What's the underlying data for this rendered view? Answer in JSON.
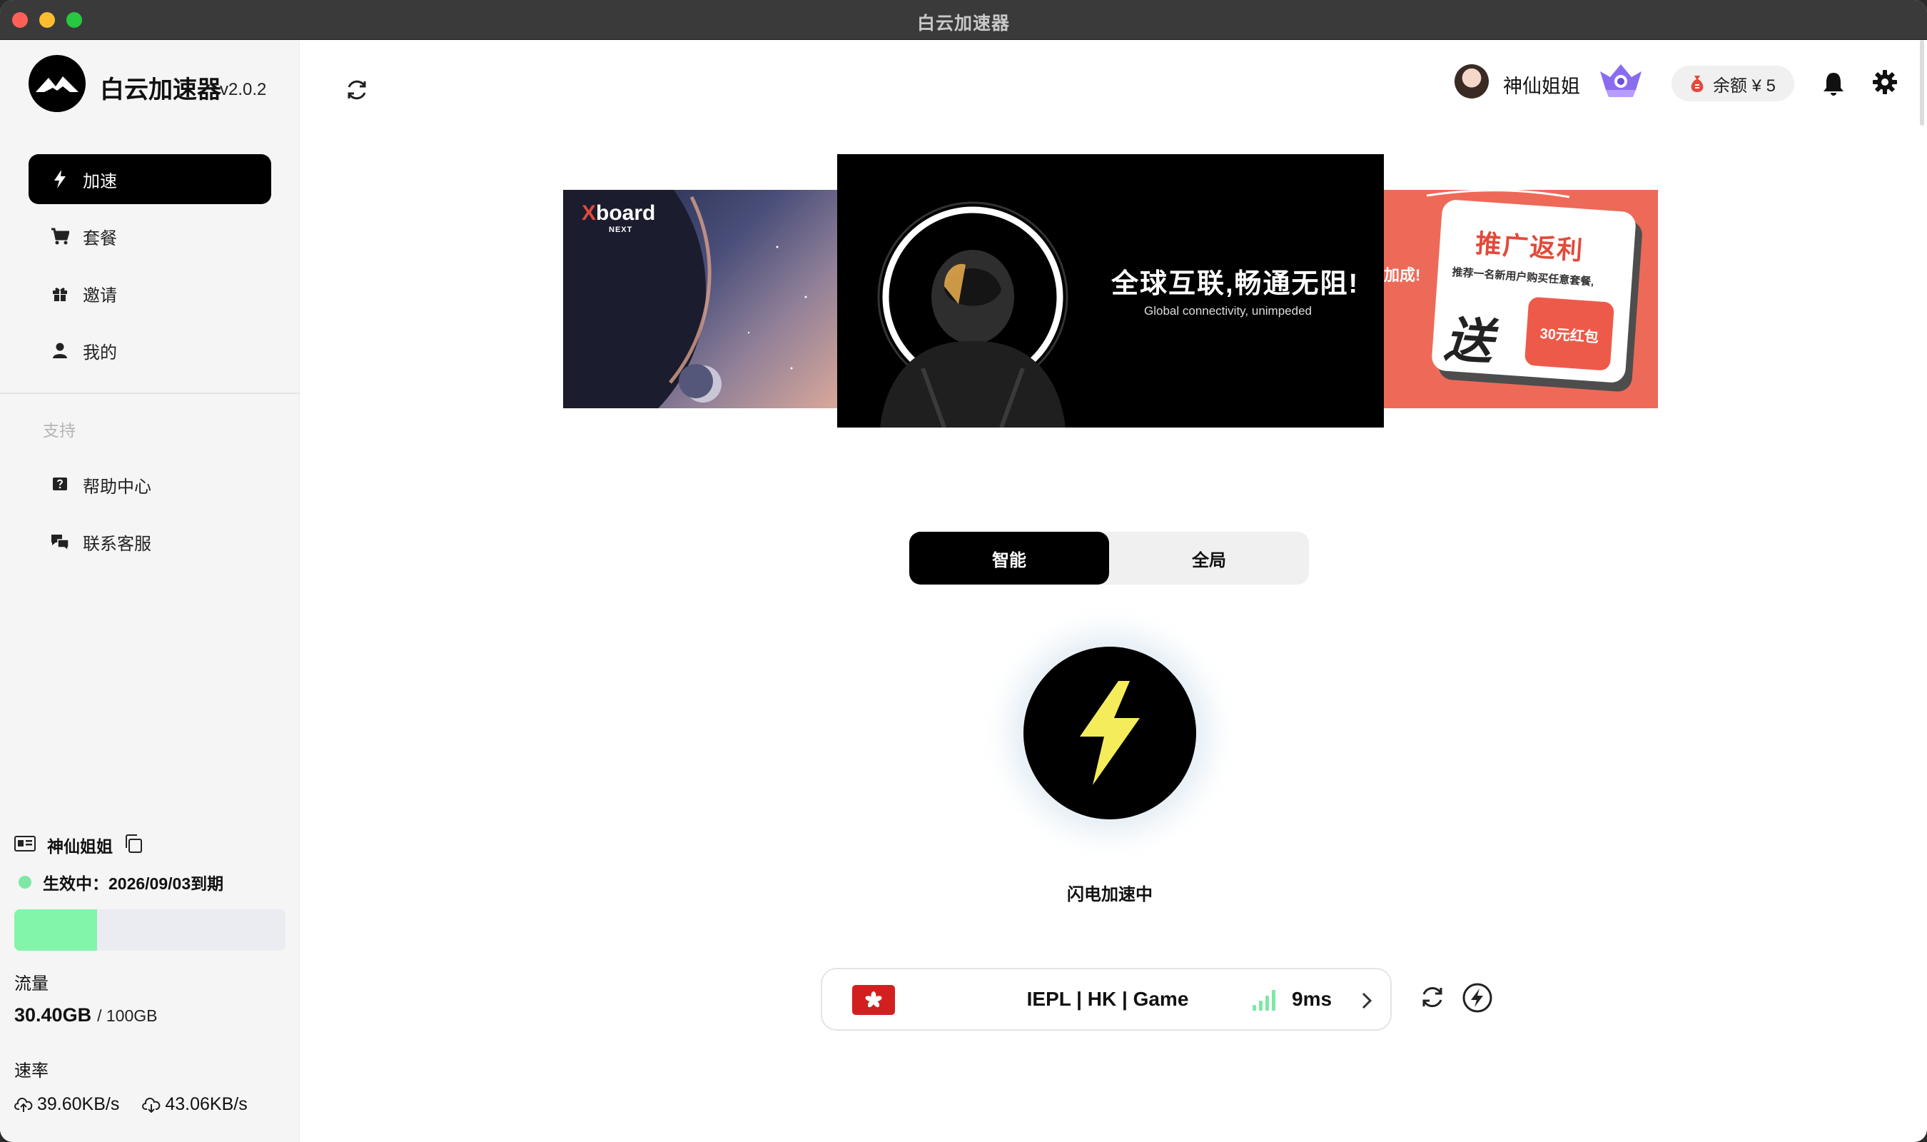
{
  "window": {
    "title": "白云加速器"
  },
  "app": {
    "name": "白云加速器",
    "version": "v2.0.2"
  },
  "sidebar": {
    "nav": [
      {
        "label": "加速",
        "icon": "lightning-icon",
        "active": true
      },
      {
        "label": "套餐",
        "icon": "cart-icon",
        "active": false
      },
      {
        "label": "邀请",
        "icon": "gift-icon",
        "active": false
      },
      {
        "label": "我的",
        "icon": "user-icon",
        "active": false
      }
    ],
    "support_label": "支持",
    "support": [
      {
        "label": "帮助中心",
        "icon": "help-icon"
      },
      {
        "label": "联系客服",
        "icon": "chat-icon"
      }
    ],
    "user": {
      "name": "神仙姐姐",
      "status": "生效中：2026/09/03到期",
      "usage_fraction": 0.304
    },
    "traffic": {
      "label": "流量",
      "used": "30.40GB",
      "total": "/ 100GB"
    },
    "speed": {
      "label": "速率",
      "upload": "39.60KB/s",
      "download": "43.06KB/s"
    }
  },
  "header": {
    "username": "神仙姐姐",
    "balance": "余额 ¥ 5"
  },
  "banners": {
    "left": {
      "logo_x": "X",
      "logo_rest": "board",
      "logo_sub": "NEXT"
    },
    "center": {
      "headline": "全球互联,畅通无阻!",
      "tagline": "Global connectivity, unimpeded"
    },
    "right": {
      "edge_text": "加成!",
      "title": "推广返利",
      "desc": "推荐一名新用户购买任意套餐,",
      "big": "送",
      "reward": "30元红包"
    }
  },
  "mode": {
    "tabs": [
      {
        "label": "智能",
        "active": true
      },
      {
        "label": "全局",
        "active": false
      }
    ]
  },
  "boost": {
    "status": "闪电加速中"
  },
  "node": {
    "name": "IEPL | HK | Game",
    "latency": "9ms",
    "signal_color": "#7de8a5"
  },
  "colors": {
    "accent": "#000000",
    "progress": "#82f5aa",
    "bolt": "#f5ec5c",
    "flag": "#d22020"
  }
}
